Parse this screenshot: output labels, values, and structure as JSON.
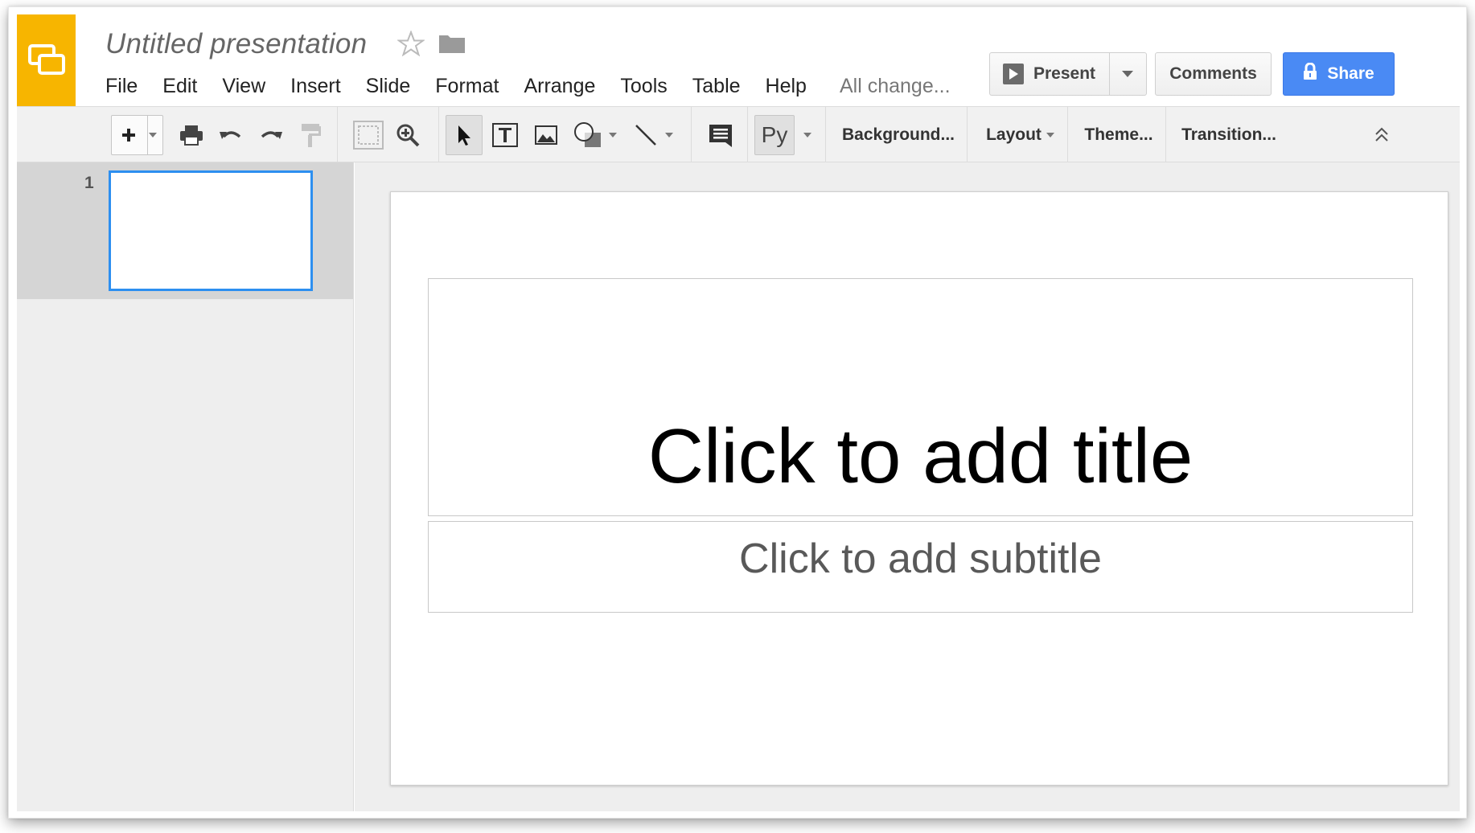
{
  "app": {
    "title": "Untitled presentation",
    "save_status": "All change..."
  },
  "menu": [
    "File",
    "Edit",
    "View",
    "Insert",
    "Slide",
    "Format",
    "Arrange",
    "Tools",
    "Table",
    "Help"
  ],
  "header": {
    "present_label": "Present",
    "comments_label": "Comments",
    "share_label": "Share"
  },
  "toolbar": {
    "spellcheck_label": "Py",
    "background_label": "Background...",
    "layout_label": "Layout",
    "theme_label": "Theme...",
    "transition_label": "Transition..."
  },
  "slides": [
    {
      "number": "1"
    }
  ],
  "slide": {
    "title_placeholder": "Click to add title",
    "subtitle_placeholder": "Click to add subtitle"
  },
  "colors": {
    "brand": "#f7b500",
    "share": "#4a8af4",
    "selection": "#2d8ff0"
  }
}
